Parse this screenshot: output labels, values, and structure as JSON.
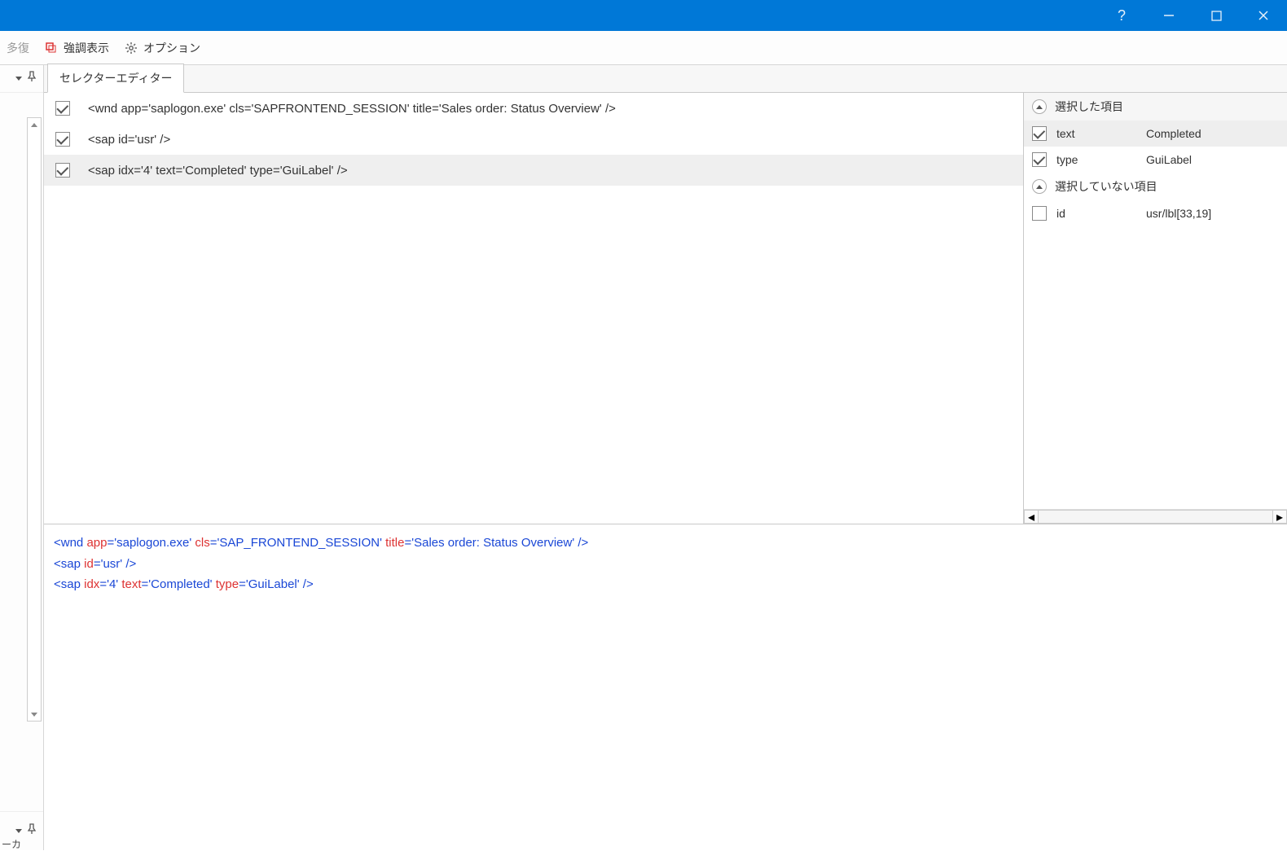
{
  "toolbar": {
    "repair": "修復",
    "repair_truncated": "多復",
    "highlight": "強調表示",
    "options": "オプション"
  },
  "tab": {
    "label": "セレクターエディター"
  },
  "selector_rows": [
    {
      "checked": true,
      "text": "<wnd app='saplogon.exe' cls='SAPFRONTEND_SESSION' title='Sales order: Status Overview' />"
    },
    {
      "checked": true,
      "text": "<sap id='usr' />"
    },
    {
      "checked": true,
      "selected": true,
      "text": "<sap idx='4' text='Completed' type='GuiLabel' />"
    }
  ],
  "side": {
    "selected_hdr": "選択した項目",
    "unselected_hdr": "選択していない項目",
    "selected": [
      {
        "checked": true,
        "name": "text",
        "value": "Completed",
        "highlight": true
      },
      {
        "checked": true,
        "name": "type",
        "value": "GuiLabel"
      }
    ],
    "unselected": [
      {
        "checked": false,
        "name": "id",
        "value": "usr/lbl[33,19]"
      }
    ]
  },
  "xml": {
    "lines": [
      {
        "tag_open": "<wnd ",
        "pairs": [
          [
            "app",
            "'saplogon.exe'"
          ],
          [
            "cls",
            "'SAP_FRONTEND_SESSION'"
          ],
          [
            "title",
            "'Sales order: Status Overview'"
          ]
        ],
        "tag_close": " />"
      },
      {
        "tag_open": "<sap ",
        "pairs": [
          [
            "id",
            "'usr'"
          ]
        ],
        "tag_close": " />"
      },
      {
        "tag_open": "<sap ",
        "pairs": [
          [
            "idx",
            "'4'"
          ],
          [
            "text",
            "'Completed'"
          ],
          [
            "type",
            "'GuiLabel'"
          ]
        ],
        "tag_close": " />"
      }
    ]
  },
  "gutter_bottom_label": "ーカ"
}
